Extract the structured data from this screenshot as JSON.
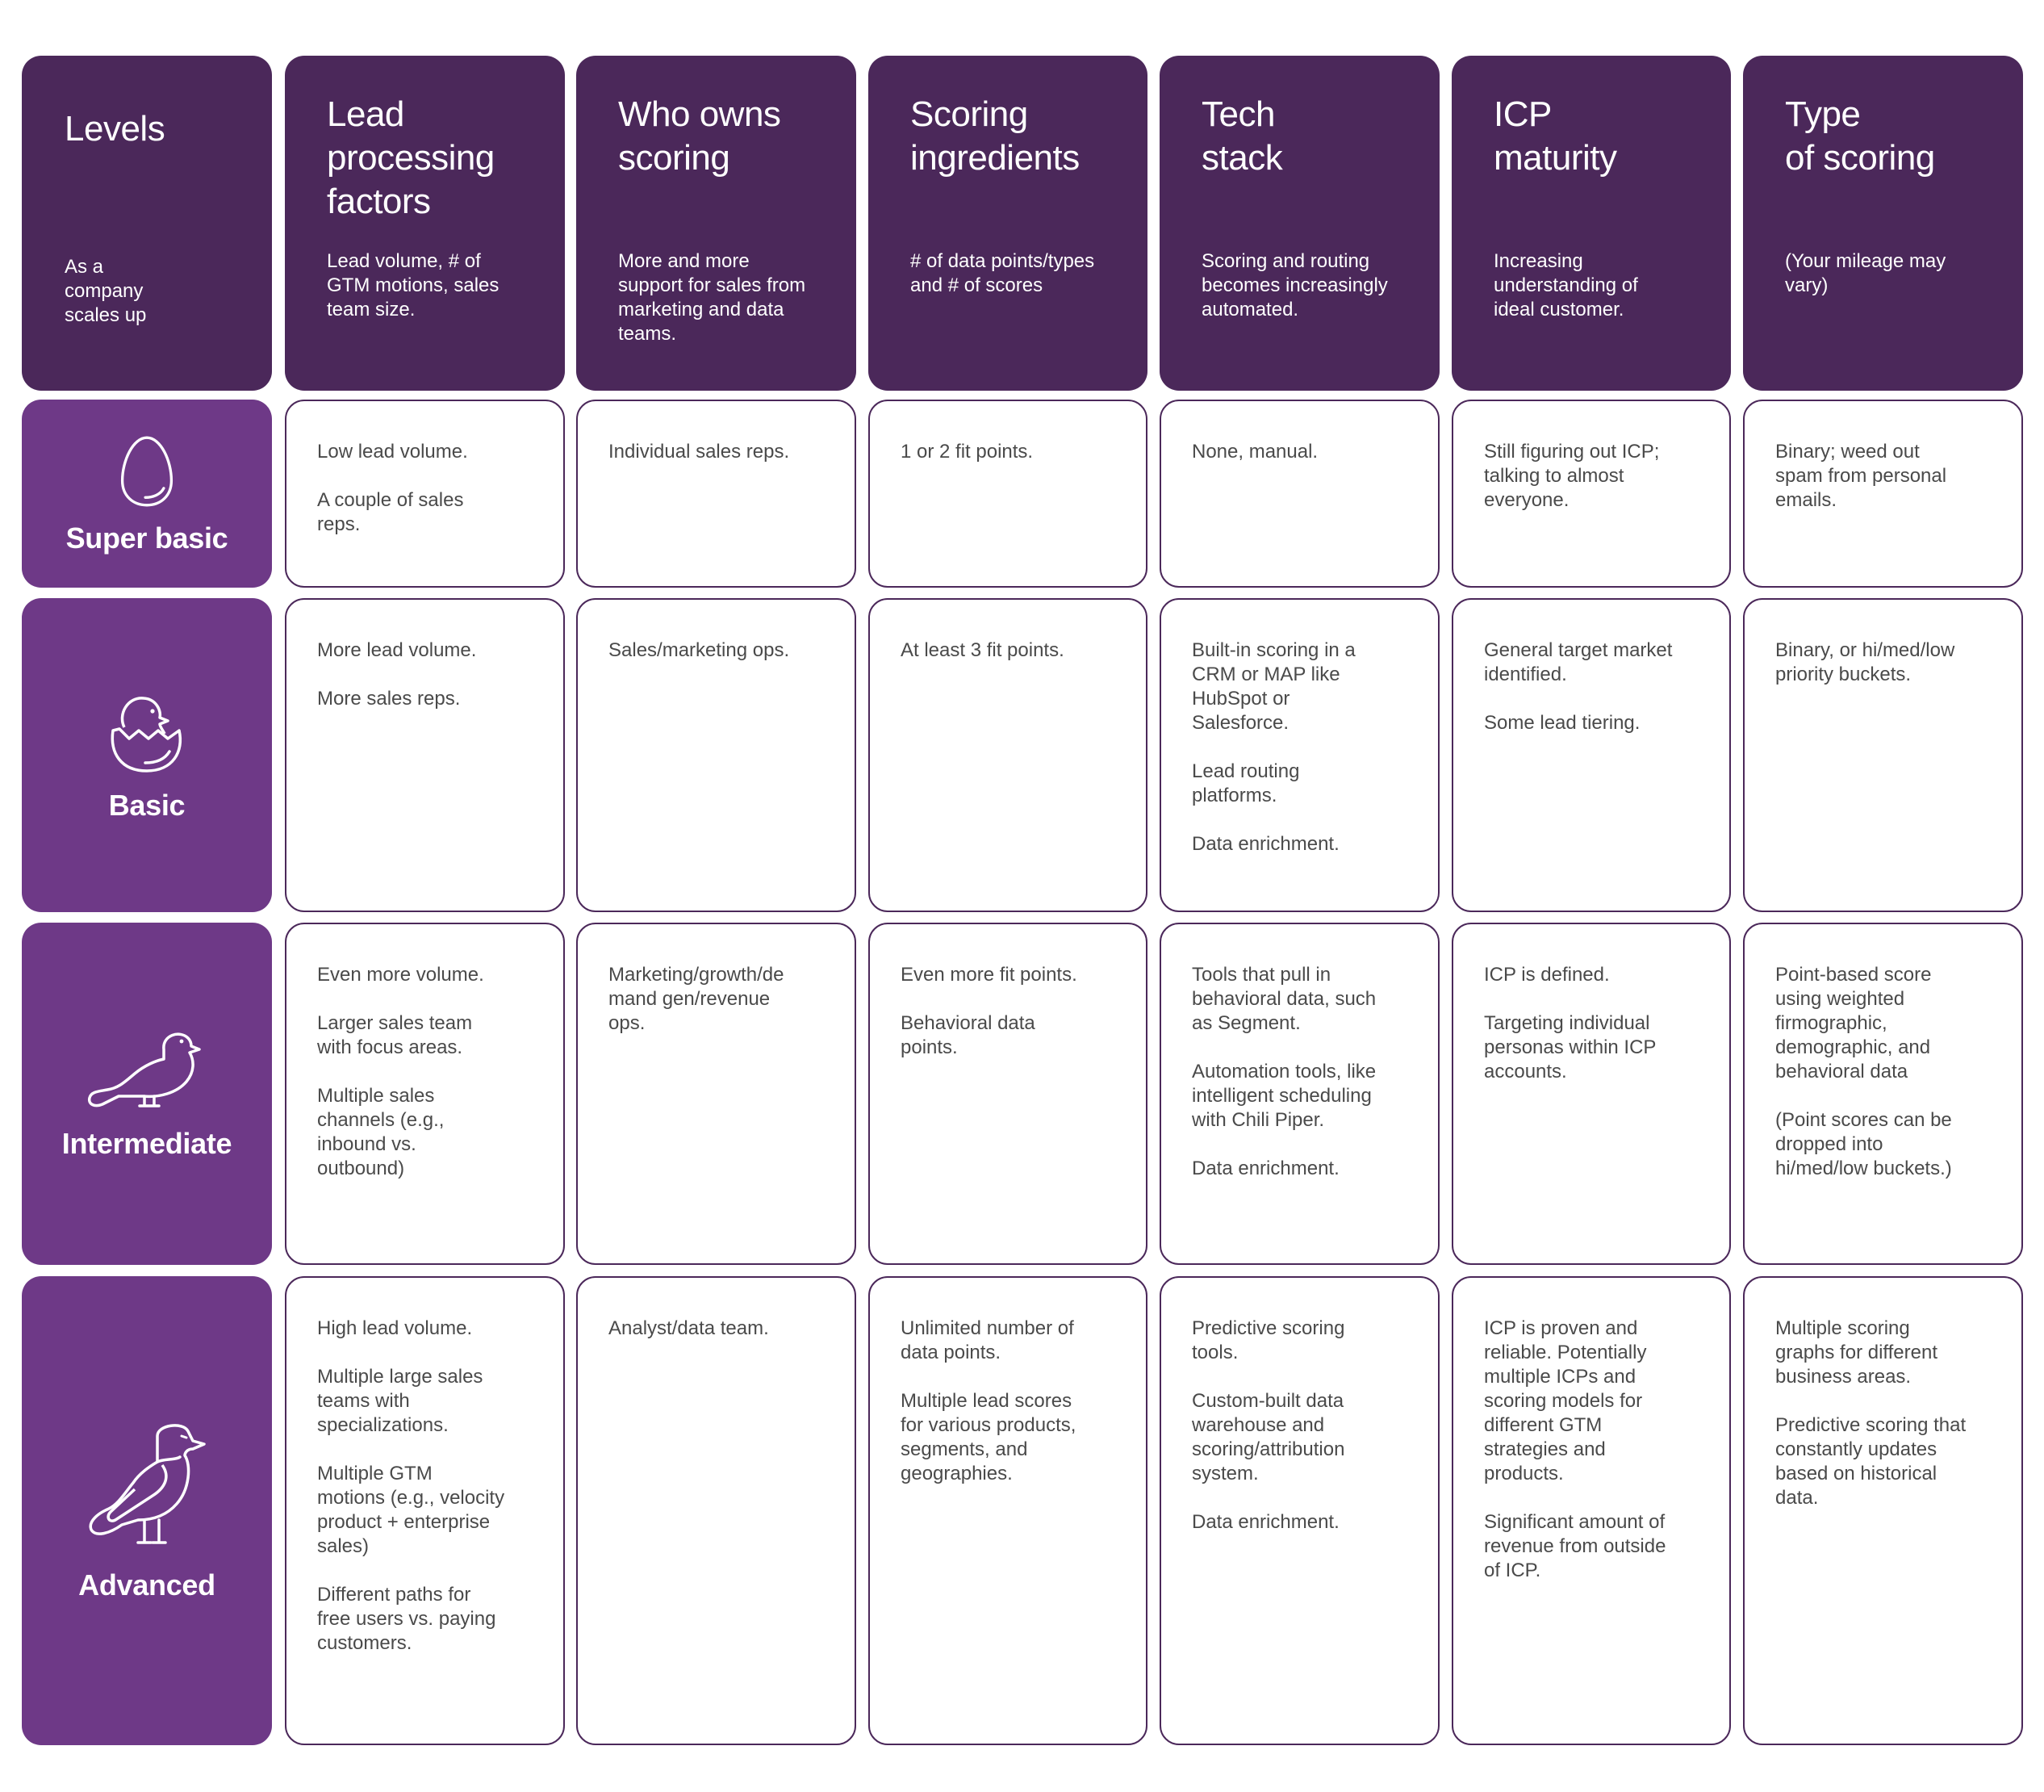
{
  "colors": {
    "header_bg": "#4b285a",
    "level_bg": "#6e3987",
    "cell_border": "#4b285a",
    "body_text": "#4a4a4a"
  },
  "levels_header": {
    "title": "Levels",
    "subtitle": "As a\ncompany\nscales up"
  },
  "columns": [
    {
      "title": "Lead\nprocessing\nfactors",
      "subtitle": "Lead volume, # of\nGTM motions, sales\nteam size."
    },
    {
      "title": "Who owns\nscoring",
      "subtitle": "More and more\nsupport for sales from\nmarketing and  data\nteams."
    },
    {
      "title": "Scoring\ningredients",
      "subtitle": "# of data points/types\nand # of scores"
    },
    {
      "title": "Tech\nstack",
      "subtitle": "Scoring and routing\nbecomes increasingly\nautomated."
    },
    {
      "title": "ICP\nmaturity",
      "subtitle": "Increasing\nunderstanding of\nideal customer."
    },
    {
      "title": "Type\nof scoring",
      "subtitle": "(Your mileage may\nvary)"
    }
  ],
  "rows": [
    {
      "level": "Super basic",
      "icon": "egg-icon",
      "cells": [
        [
          "Low lead volume.",
          "A couple of sales\nreps."
        ],
        [
          "Individual sales reps."
        ],
        [
          "1 or 2 fit points."
        ],
        [
          "None, manual."
        ],
        [
          "Still figuring out ICP;\ntalking to almost\neveryone."
        ],
        [
          "Binary; weed out\nspam from personal\nemails."
        ]
      ]
    },
    {
      "level": "Basic",
      "icon": "hatching-chick-icon",
      "cells": [
        [
          "More lead volume.",
          "More sales reps."
        ],
        [
          "Sales/marketing ops."
        ],
        [
          "At least 3 fit points."
        ],
        [
          "Built-in scoring in a\nCRM or MAP like\nHubSpot or\nSalesforce.",
          "Lead routing\nplatforms.",
          "Data enrichment."
        ],
        [
          "General target market\nidentified.",
          "Some lead tiering."
        ],
        [
          "Binary, or hi/med/low\npriority buckets."
        ]
      ]
    },
    {
      "level": "Intermediate",
      "icon": "young-bird-icon",
      "cells": [
        [
          "Even more volume.",
          "Larger sales team\nwith focus areas.",
          "Multiple sales\nchannels (e.g.,\ninbound vs.\noutbound)"
        ],
        [
          "Marketing/growth/de\nmand gen/revenue\nops."
        ],
        [
          "Even more fit points.",
          "Behavioral data\npoints."
        ],
        [
          "Tools that pull in\nbehavioral data, such\nas Segment.",
          "Automation tools, like\nintelligent scheduling\nwith Chili Piper.",
          "Data enrichment."
        ],
        [
          "ICP is defined.",
          "Targeting individual\npersonas within ICP\naccounts."
        ],
        [
          "Point-based score\nusing weighted\nfirmographic,\ndemographic, and\nbehavioral data",
          "(Point scores can be\ndropped into\nhi/med/low buckets.)"
        ]
      ]
    },
    {
      "level": "Advanced",
      "icon": "adult-bird-icon",
      "cells": [
        [
          "High lead volume.",
          "Multiple large sales\nteams with\nspecializations.",
          "Multiple GTM\nmotions (e.g., velocity\nproduct + enterprise\nsales)",
          "Different paths for\nfree users vs. paying\ncustomers."
        ],
        [
          "Analyst/data team."
        ],
        [
          "Unlimited number of\ndata points.",
          "Multiple lead scores\nfor various products,\nsegments, and\ngeographies."
        ],
        [
          "Predictive scoring\ntools.",
          "Custom-built data\nwarehouse and\nscoring/attribution\nsystem.",
          "Data enrichment."
        ],
        [
          "ICP is proven and\nreliable. Potentially\nmultiple ICPs and\nscoring models for\ndifferent GTM\nstrategies and\nproducts.",
          "Significant amount of\nrevenue from outside\nof ICP."
        ],
        [
          "Multiple scoring\ngraphs for different\nbusiness areas.",
          "Predictive scoring that\nconstantly updates\nbased on historical\ndata."
        ]
      ]
    }
  ]
}
